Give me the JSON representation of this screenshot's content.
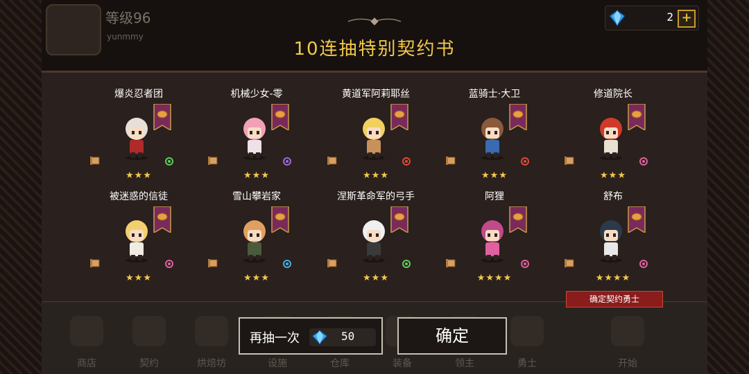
{
  "player": {
    "level": "等级96",
    "username": "yunmmy"
  },
  "gems": {
    "count": "2",
    "plus": "+"
  },
  "title": "10连抽特别契约书",
  "heroes": [
    {
      "name": "爆炎忍者团",
      "stars": "★★★",
      "hair": "#e8e0d8",
      "outfit": "#b02a2a",
      "class_icon": "shuriken-icon",
      "class_color": "#5ad05a"
    },
    {
      "name": "机械少女-零",
      "stars": "★★★",
      "hair": "#f2a0b8",
      "outfit": "#f0e0e8",
      "class_icon": "wand-icon",
      "class_color": "#9a6ae0"
    },
    {
      "name": "黄道军阿莉耶丝",
      "stars": "★★★",
      "hair": "#f2d060",
      "outfit": "#c8905a",
      "class_icon": "sword-icon",
      "class_color": "#e04a3a"
    },
    {
      "name": "蓝骑士·大卫",
      "stars": "★★★",
      "hair": "#8a5a3a",
      "outfit": "#3a6ab0",
      "class_icon": "sword-icon",
      "class_color": "#e04a3a"
    },
    {
      "name": "修道院长",
      "stars": "★★★",
      "hair": "#d03a2a",
      "outfit": "#e8e0d0",
      "class_icon": "potion-icon",
      "class_color": "#e060a0"
    },
    {
      "name": "被迷惑的信徒",
      "stars": "★★★",
      "hair": "#f2d070",
      "outfit": "#f0ece4",
      "class_icon": "potion-icon",
      "class_color": "#e060a0"
    },
    {
      "name": "雪山攀岩家",
      "stars": "★★★",
      "hair": "#e0a060",
      "outfit": "#4a5a3a",
      "class_icon": "hammer-icon",
      "class_color": "#40b0e0"
    },
    {
      "name": "涅斯革命军的弓手",
      "stars": "★★★",
      "hair": "#f0f0f0",
      "outfit": "#3a3a3a",
      "class_icon": "shuriken-icon",
      "class_color": "#5ad05a"
    },
    {
      "name": "阿狸",
      "stars": "★★★★",
      "hair": "#c04a8a",
      "outfit": "#e060a0",
      "class_icon": "potion-icon",
      "class_color": "#e060a0"
    },
    {
      "name": "舒布",
      "stars": "★★★★",
      "hair": "#2a3a4a",
      "outfit": "#e8e8e8",
      "class_icon": "potion-icon",
      "class_color": "#e060a0"
    }
  ],
  "confirm_tag": "确定契约勇士",
  "dock": [
    "商店",
    "契约",
    "烘焙坊",
    "设施",
    "仓库",
    "装备",
    "领主",
    "勇士",
    "开始"
  ],
  "buttons": {
    "again_label": "再抽一次",
    "again_cost": "50",
    "ok_label": "确定"
  },
  "colors": {
    "title": "#f2c94c",
    "star": "#f2c94c",
    "banner": "#7a2a5a",
    "gem": "#3aa0e8"
  }
}
